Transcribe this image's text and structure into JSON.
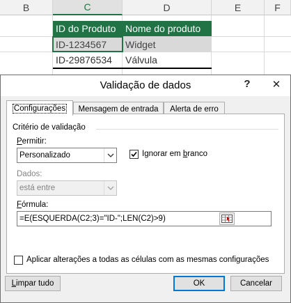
{
  "sheet": {
    "columns": [
      "B",
      "C",
      "D",
      "E",
      "F"
    ],
    "active_column": "C",
    "rows": [
      [
        "ID do Produto",
        "Nome do produto"
      ],
      [
        "ID-1234567",
        "Widget"
      ],
      [
        "ID-29876534",
        "Válvula"
      ]
    ],
    "colors": {
      "header_fill": "#217346",
      "header_text": "#ffffff",
      "selection": "#217346"
    }
  },
  "dialog": {
    "title": "Validação de dados",
    "help_button": "?",
    "close_button": "✕",
    "tabs": [
      "Configurações",
      "Mensagem de entrada",
      "Alerta de erro"
    ],
    "active_tab": "Configurações",
    "section_label": "Critério de validação",
    "allow": {
      "label_hotkey": "P",
      "label_rest": "ermitir:",
      "value": "Personalizado"
    },
    "ignore_blank": {
      "label_pre": "Ignorar em ",
      "label_hotkey": "b",
      "label_rest": "ranco",
      "checked": true
    },
    "data": {
      "label": "Dados:",
      "value": "está entre"
    },
    "formula": {
      "label_hotkey": "F",
      "label_rest": "órmula:",
      "value": "=E(ESQUERDA(C2;3)=\"ID-\";LEN(C2)>9)"
    },
    "apply_all": {
      "label": "Aplicar alterações a todas as células com as mesmas configurações",
      "checked": false
    },
    "buttons": {
      "clear_all_hotkey": "L",
      "clear_all_rest": "impar tudo",
      "ok": "OK",
      "cancel": "Cancelar"
    }
  }
}
